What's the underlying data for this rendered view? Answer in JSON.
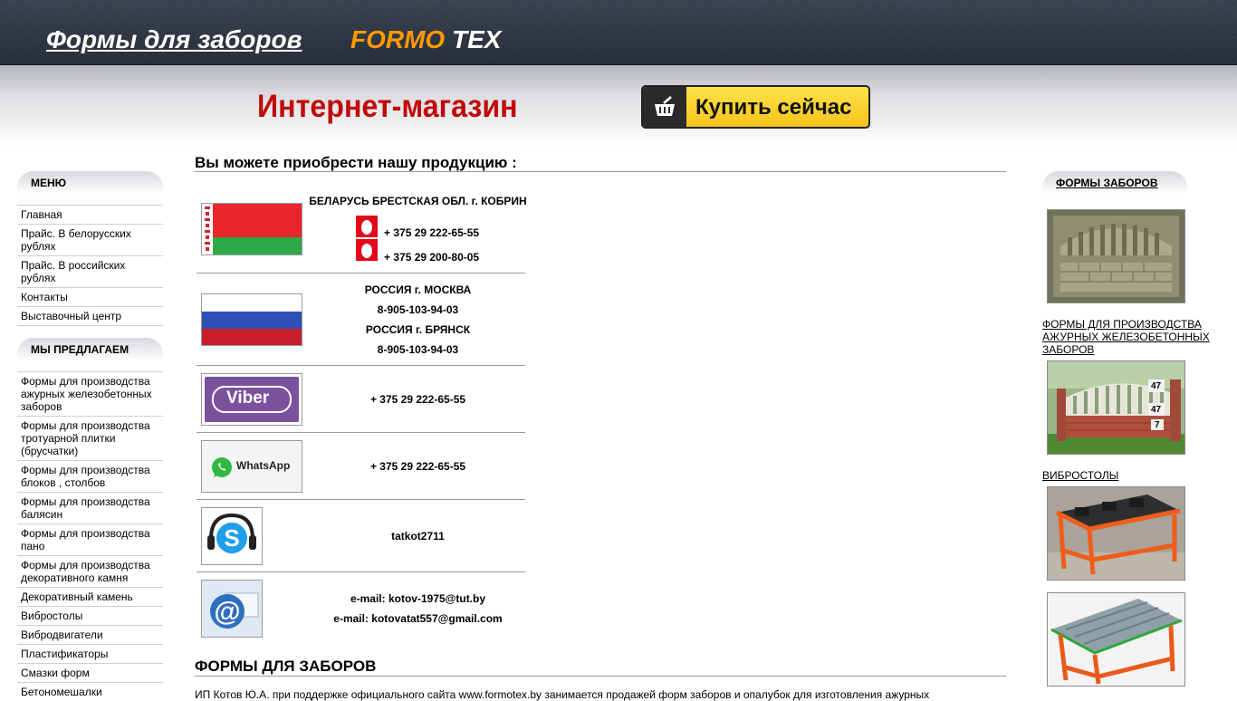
{
  "header": {
    "site_title": "Формы для заборов",
    "brand_part1": "FORMO",
    "brand_part2": "TEX",
    "shop_title": "Интернет-магазин",
    "buy_button": "Купить сейчас"
  },
  "left_menu": {
    "title": "МЕНЮ",
    "items": [
      "Главная",
      "Прайс. В белорусских рублях",
      "Прайс. В российских рублях",
      "Контакты",
      "Выставочный центр"
    ]
  },
  "offer_menu": {
    "title": "МЫ ПРЕДЛАГАЕМ",
    "items": [
      "Формы для производства ажурных железобетонных заборов",
      "Формы для производства тротуарной плитки (брусчатки)",
      "Формы для производства блоков , столбов",
      "Формы для производства балясин",
      "Формы для производства пано",
      "Формы для производства декоративного камня",
      "Декоративный камень",
      "Вибростолы",
      "Вибродвигатели",
      "Пластификаторы",
      "Смазки форм",
      "Бетономешалки"
    ]
  },
  "main": {
    "heading": "Вы можете приобрести нашу продукцию :",
    "contacts": {
      "belarus_region": "БЕЛАРУСЬ БРЕСТСКАЯ ОБЛ. г. КОБРИН",
      "belarus_phone1": "+ 375 29 222-65-55",
      "belarus_phone2": "+ 375 29 200-80-05",
      "russia_city1": "РОССИЯ г. МОСКВА",
      "russia_phone1": "8-905-103-94-03",
      "russia_city2": "РОССИЯ г. БРЯНСК",
      "russia_phone2": "8-905-103-94-03",
      "viber_label": "Viber",
      "viber_phone": "+ 375 29 222-65-55",
      "whatsapp_label": "WhatsApp",
      "whatsapp_phone": "+ 375 29 222-65-55",
      "skype_login": "tatkot2711",
      "email1": "e-mail: kotov-1975@tut.by",
      "email2": "e-mail: kotovatat557@gmail.com"
    },
    "section2_heading": "ФОРМЫ ДЛЯ ЗАБОРОВ",
    "intro_text": "ИП Котов Ю.А. при поддержке официального сайта www.formotex.by занимается продажей форм заборов и опалубок для изготовления ажурных"
  },
  "right": {
    "title": "ФОРМЫ ЗАБОРОВ",
    "link1": "ФОРМЫ ДЛЯ ПРОИЗВОДСТВА АЖУРНЫХ ЖЕЛЕЗОБЕТОННЫХ ЗАБОРОВ",
    "link2": "ВИБРОСТОЛЫ",
    "fence_numbers": [
      "47",
      "47",
      "7"
    ]
  }
}
